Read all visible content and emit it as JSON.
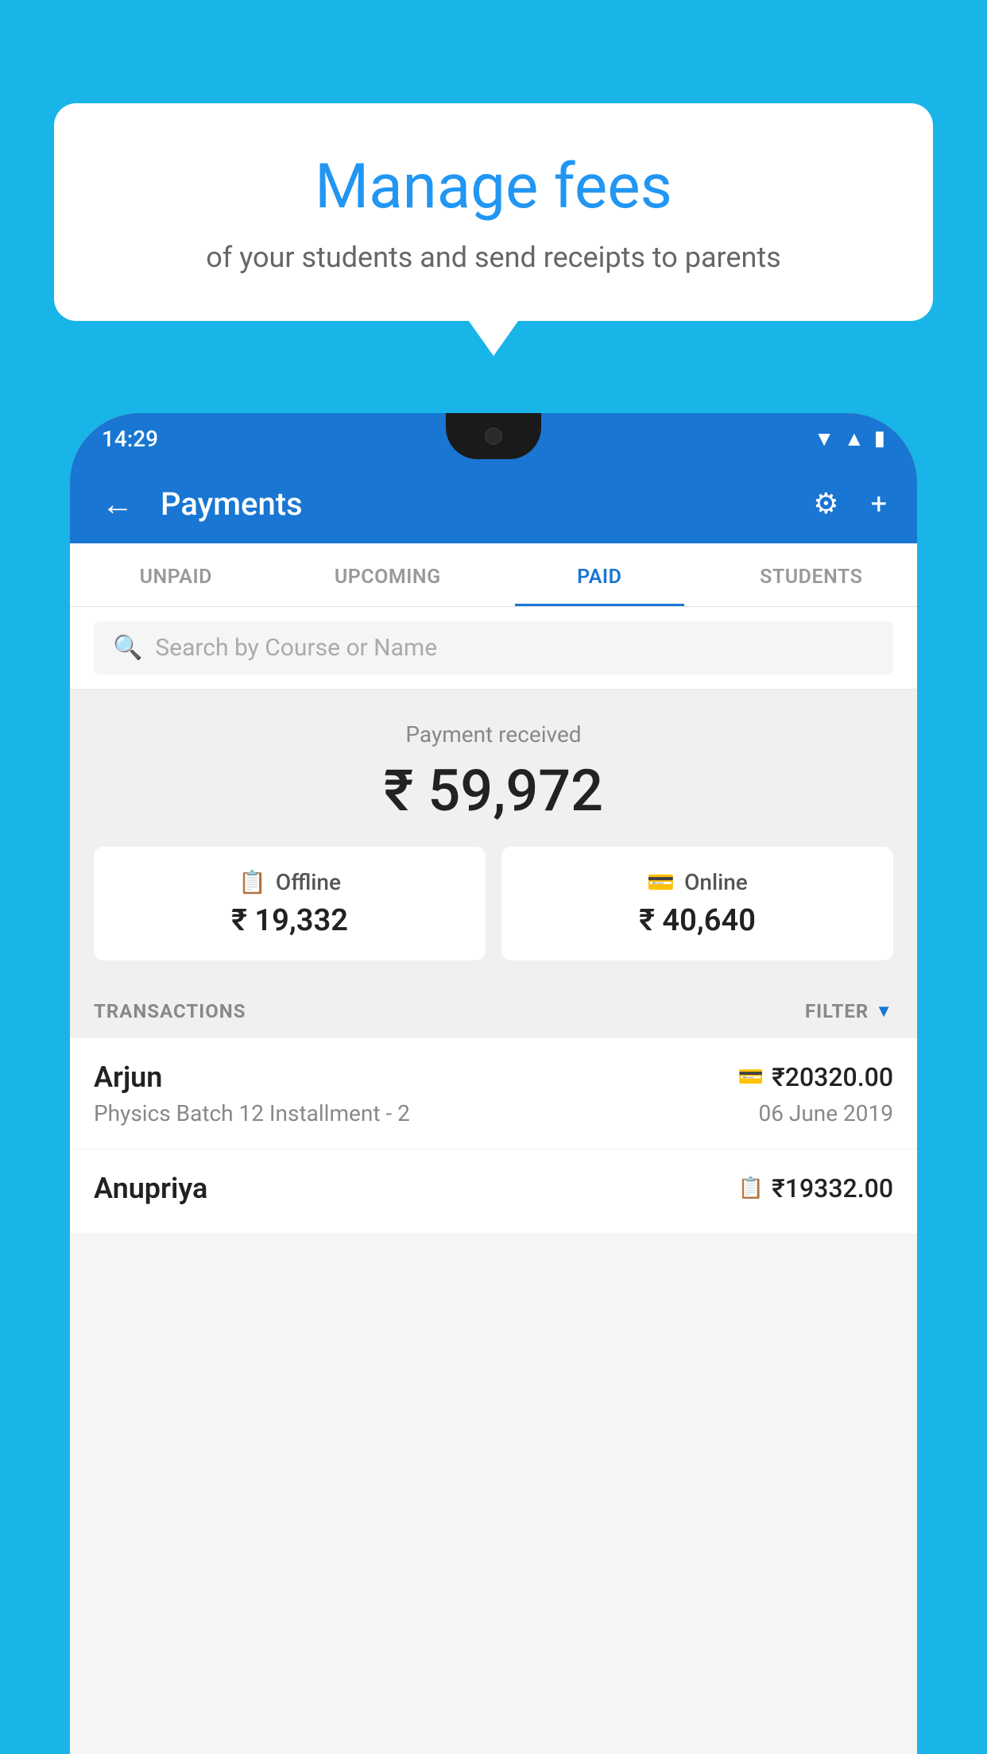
{
  "bubble": {
    "title": "Manage fees",
    "subtitle": "of your students and send receipts to parents"
  },
  "status": {
    "time": "14:29"
  },
  "header": {
    "title": "Payments",
    "back_label": "←",
    "settings_label": "⚙",
    "add_label": "+"
  },
  "tabs": [
    {
      "label": "UNPAID",
      "active": false
    },
    {
      "label": "UPCOMING",
      "active": false
    },
    {
      "label": "PAID",
      "active": true
    },
    {
      "label": "STUDENTS",
      "active": false
    }
  ],
  "search": {
    "placeholder": "Search by Course or Name"
  },
  "payment": {
    "received_label": "Payment received",
    "total_amount": "₹ 59,972",
    "offline_label": "Offline",
    "offline_amount": "₹ 19,332",
    "online_label": "Online",
    "online_amount": "₹ 40,640"
  },
  "transactions": {
    "header_label": "TRANSACTIONS",
    "filter_label": "FILTER",
    "items": [
      {
        "name": "Arjun",
        "course": "Physics Batch 12 Installment - 2",
        "amount": "₹20320.00",
        "date": "06 June 2019",
        "payment_type": "card"
      },
      {
        "name": "Anupriya",
        "course": "",
        "amount": "₹19332.00",
        "date": "",
        "payment_type": "cash"
      }
    ]
  }
}
